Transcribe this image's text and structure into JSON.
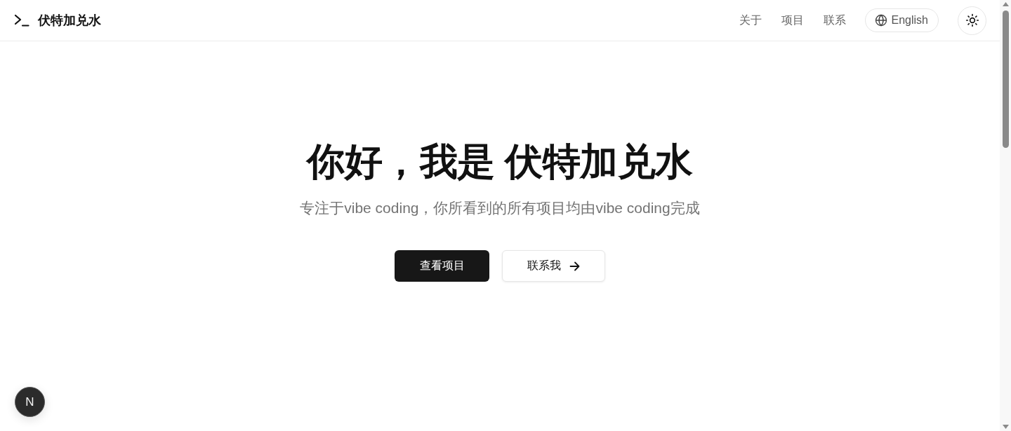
{
  "header": {
    "logo": {
      "title": "伏特加兑水"
    },
    "nav": [
      {
        "label": "关于"
      },
      {
        "label": "项目"
      },
      {
        "label": "联系"
      }
    ],
    "language_button": {
      "label": "English"
    }
  },
  "hero": {
    "title": "你好，我是 伏特加兑水",
    "subtitle": "专注于vibe coding，你所看到的所有项目均由vibe coding完成",
    "buttons": [
      {
        "label": "查看项目",
        "kind": "primary"
      },
      {
        "label": "联系我",
        "kind": "secondary"
      }
    ]
  },
  "dev_badge": {
    "label": "N"
  }
}
